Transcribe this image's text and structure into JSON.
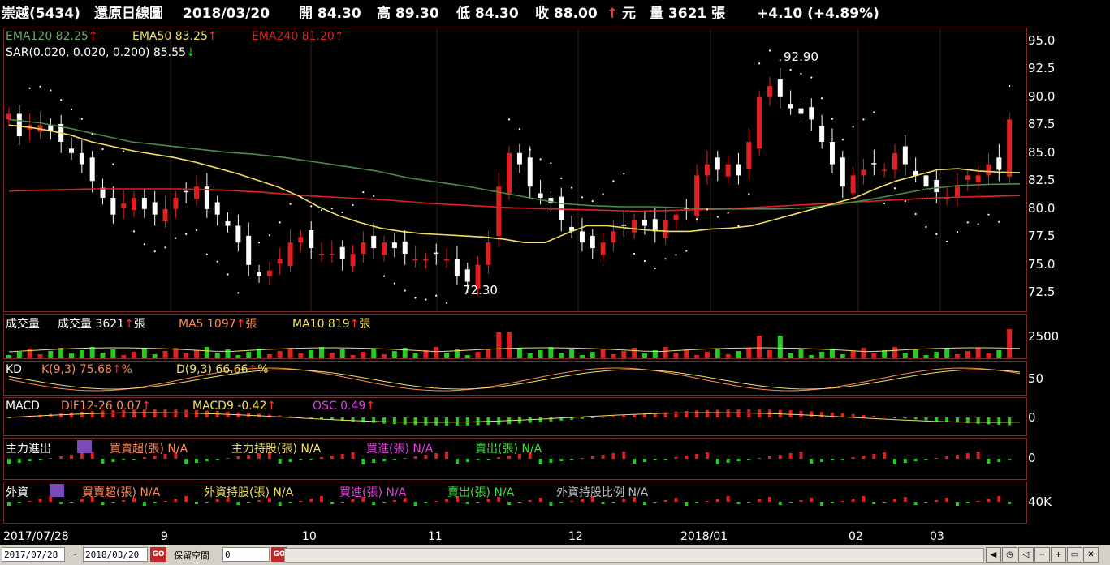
{
  "header": {
    "stock": "崇越(5434)",
    "chart_kind": "還原日線圖",
    "date": "2018/03/20",
    "open": "開 84.30",
    "high": "高 89.30",
    "low": "低 84.30",
    "close": "收 88.00",
    "close_arrow": "↑",
    "unit": "元",
    "volume": "量 3621 張",
    "change": "+4.10 (+4.89%)"
  },
  "price_legend": {
    "ema120": "EMA120 82.25",
    "ema50": "EMA50 83.25",
    "ema240": "EMA240 81.20",
    "sar": "SAR(0.020, 0.020, 0.200) 85.55",
    "up": "↑",
    "down": "↓"
  },
  "volume_legend": {
    "title": "成交量",
    "vol": "成交量 3621",
    "ma5": "MA5 1097",
    "ma10": "MA10 819",
    "unit": "張",
    "up": "↑"
  },
  "kd_legend": {
    "title": "KD",
    "k": "K(9,3) 75.68",
    "d": "D(9,3) 66.66",
    "unit": "%",
    "up": "↑"
  },
  "macd_legend": {
    "title": "MACD",
    "dif": "DIF12-26 0.07",
    "macd": "MACD9 -0.42",
    "osc": "OSC 0.49",
    "up": "↑"
  },
  "main_force_legend": {
    "title": "主力進出",
    "net": "買賣超(張) N/A",
    "hold": "主力持股(張) N/A",
    "buy": "買進(張) N/A",
    "sell": "賣出(張) N/A"
  },
  "foreign_legend": {
    "title": "外資",
    "net": "買賣超(張) N/A",
    "hold": "外資持股(張) N/A",
    "buy": "買進(張) N/A",
    "sell": "賣出(張) N/A",
    "ratio": "外資持股比例 N/A"
  },
  "scales": {
    "price_ticks": [
      "95.0",
      "92.5",
      "90.0",
      "87.5",
      "85.0",
      "82.5",
      "80.0",
      "77.5",
      "75.0",
      "72.5"
    ],
    "volume_tick": "2500",
    "kd_tick": "50",
    "macd_tick": "0",
    "main_force_tick": "0",
    "foreign_tick": "40K"
  },
  "x_labels": [
    "2017/07/28",
    "9",
    "10",
    "11",
    "12",
    "2018/01",
    "02",
    "03"
  ],
  "annotations": {
    "high": "92.90",
    "low": "72.30"
  },
  "bottom_bar": {
    "start_date": "2017/07/28",
    "tilde": "~",
    "end_date": "2018/03/20",
    "go": "GO",
    "reserve_label": "保留空間",
    "reserve_value": "0"
  },
  "colors": {
    "up": "#e02020",
    "down": "#ffffff",
    "vol_up": "#e02020",
    "vol_down": "#22cc22",
    "ema50": "#f0e060",
    "ema120": "#4a8a4a",
    "ema240": "#e02020",
    "sar": "#ffffff"
  },
  "chart_data": {
    "type": "candlestick",
    "title": "崇越(5434) 還原日線圖",
    "ylim": [
      71,
      96
    ],
    "close_series_approx": [
      88.5,
      86.5,
      87.5,
      87.5,
      87,
      86,
      85,
      84,
      82.5,
      81,
      79.5,
      80.5,
      81,
      80,
      79.5,
      80,
      81,
      81.5,
      82,
      80,
      79.5,
      78.5,
      77,
      75,
      74,
      74.5,
      75.5,
      77,
      77.5,
      76.5,
      76,
      76,
      75.5,
      76,
      77,
      76.5,
      77,
      76.5,
      76,
      75.5,
      75.5,
      76,
      75.5,
      74,
      73.5,
      75,
      77,
      82,
      85,
      84,
      82,
      81,
      80.5,
      79,
      78,
      77,
      76.5,
      77,
      78,
      78.5,
      79,
      78.5,
      78,
      79,
      79.5,
      80,
      83,
      84,
      83.5,
      84,
      83,
      86,
      90,
      91,
      90,
      89,
      88.5,
      88,
      86,
      84,
      82,
      83,
      83.5,
      84,
      83.5,
      85,
      84,
      83,
      82,
      81.5,
      81,
      82,
      83,
      83,
      84,
      83.5,
      88
    ],
    "ema50_approx": [
      87.5,
      87.3,
      87,
      86.6,
      86,
      85.6,
      85.2,
      84.9,
      84.6,
      84.2,
      83.7,
      83.2,
      82.6,
      82,
      81.2,
      80.2,
      79.4,
      78.8,
      78.3,
      78,
      77.8,
      77.7,
      77.6,
      77.5,
      77.3,
      77,
      77,
      77.8,
      78.5,
      78.5,
      78.3,
      78.1,
      78,
      78,
      78.2,
      78.3,
      78.5,
      79,
      79.5,
      80,
      80.5,
      81,
      81.8,
      82.5,
      83,
      83.5,
      83.6,
      83.4,
      83.3,
      83.25
    ],
    "ema120_approx": [
      88,
      87.7,
      87.2,
      86.6,
      86,
      85.7,
      85.4,
      85.1,
      84.9,
      84.6,
      84.2,
      83.8,
      83.4,
      82.8,
      82.4,
      82,
      81.5,
      81,
      80.5,
      80.3,
      80.2,
      80.2,
      80.1,
      80,
      80,
      80,
      80.1,
      80.4,
      80.8,
      81.3,
      81.8,
      82.1,
      82.2,
      82.25
    ],
    "ema240_approx": [
      81.6,
      81.7,
      81.8,
      81.8,
      81.8,
      81.7,
      81.5,
      81.2,
      81,
      80.8,
      80.5,
      80.3,
      80.1,
      80,
      79.9,
      79.8,
      79.9,
      80,
      80.2,
      80.4,
      80.6,
      80.8,
      81,
      81.1,
      81.2
    ]
  }
}
